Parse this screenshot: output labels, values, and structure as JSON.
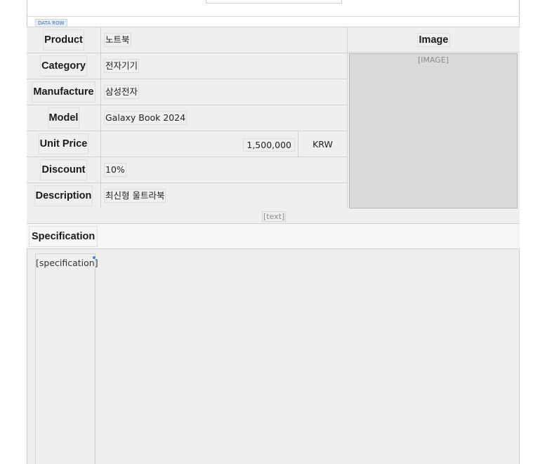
{
  "badge": "DATA ROW",
  "fields": [
    {
      "label": "Product",
      "value": "노트북"
    },
    {
      "label": "Category",
      "value": "전자기기"
    },
    {
      "label": "Manufacture",
      "value": "삼성전자"
    },
    {
      "label": "Model",
      "value": "Galaxy Book 2024"
    },
    {
      "label": "Unit Price",
      "value": "1,500,000",
      "currency": "KRW"
    },
    {
      "label": "Discount",
      "value": "10%"
    },
    {
      "label": "Description",
      "value": "최신형 울트라북"
    }
  ],
  "image": {
    "header": "Image",
    "placeholder": "[IMAGE]"
  },
  "text_placeholder": "[text]",
  "specification": {
    "header": "Specification",
    "placeholder": "[specification]"
  }
}
